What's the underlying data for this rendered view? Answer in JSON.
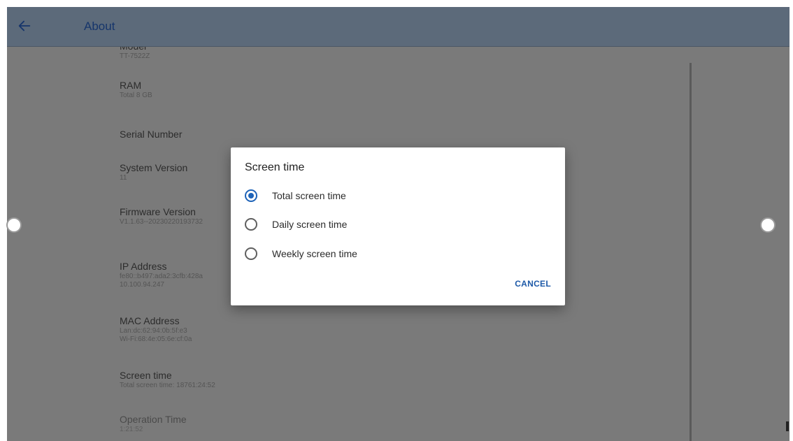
{
  "header": {
    "title": "About"
  },
  "info_items": [
    {
      "title": "Model",
      "lines": [
        "TT-7522Z"
      ]
    },
    {
      "title": "RAM",
      "lines": [
        "Total 8 GB"
      ]
    },
    {
      "title": "Serial Number",
      "lines": []
    },
    {
      "title": "System Version",
      "lines": [
        "11"
      ]
    },
    {
      "title": "Firmware Version",
      "lines": [
        "V1.1.63--20230220193732"
      ]
    },
    {
      "title": "IP Address",
      "lines": [
        "fe80::b497:ada2:3cfb:428a",
        "10.100.94.247"
      ]
    },
    {
      "title": "MAC Address",
      "lines": [
        "Lan:dc:62:94:0b:5f:e3",
        "Wi-Fi:68:4e:05:6e:cf:0a"
      ]
    },
    {
      "title": "Screen time",
      "lines": [
        "Total screen time: 18761:24:52"
      ]
    },
    {
      "title": "Operation Time",
      "lines": [
        "1:21:52"
      ]
    }
  ],
  "dialog": {
    "title": "Screen time",
    "options": [
      {
        "label": "Total screen time",
        "selected": true
      },
      {
        "label": "Daily screen time",
        "selected": false
      },
      {
        "label": "Weekly screen time",
        "selected": false
      }
    ],
    "cancel_label": "CANCEL"
  },
  "icons": {
    "back": "arrow-left-icon",
    "side": "circle-button-icon"
  },
  "colors": {
    "appbar": "#5c6a7a",
    "dimmed_background": "#7a7a7a",
    "dialog_background": "#ffffff",
    "accent": "#1e63b8"
  }
}
